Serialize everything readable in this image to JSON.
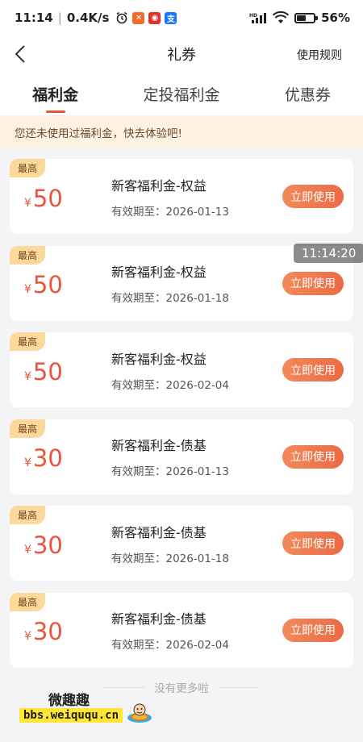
{
  "status_bar": {
    "time": "11:14",
    "speed": "0.4K/s",
    "battery": "56%",
    "battery_level": 0.56,
    "network": "HD"
  },
  "nav": {
    "title": "礼券",
    "rules": "使用规则"
  },
  "tabs": [
    {
      "label": "福利金",
      "active": true
    },
    {
      "label": "定投福利金",
      "active": false
    },
    {
      "label": "优惠券",
      "active": false
    }
  ],
  "notice": "您还未使用过福利金，快去体验吧!",
  "coupons": [
    {
      "tag": "最高",
      "currency": "¥",
      "amount": "50",
      "title": "新客福利金-权益",
      "expiry": "有效期至：2026-01-13",
      "button": "立即使用"
    },
    {
      "tag": "最高",
      "currency": "¥",
      "amount": "50",
      "title": "新客福利金-权益",
      "expiry": "有效期至：2026-01-18",
      "button": "立即使用"
    },
    {
      "tag": "最高",
      "currency": "¥",
      "amount": "50",
      "title": "新客福利金-权益",
      "expiry": "有效期至：2026-02-04",
      "button": "立即使用"
    },
    {
      "tag": "最高",
      "currency": "¥",
      "amount": "30",
      "title": "新客福利金-债基",
      "expiry": "有效期至：2026-01-13",
      "button": "立即使用"
    },
    {
      "tag": "最高",
      "currency": "¥",
      "amount": "30",
      "title": "新客福利金-债基",
      "expiry": "有效期至：2026-01-18",
      "button": "立即使用"
    },
    {
      "tag": "最高",
      "currency": "¥",
      "amount": "30",
      "title": "新客福利金-债基",
      "expiry": "有效期至：2026-02-04",
      "button": "立即使用"
    }
  ],
  "footer": "没有更多啦",
  "overlay_time": "11:14:20",
  "watermark": {
    "title": "微趣趣",
    "url": "bbs.weiququ.cn"
  },
  "colors": {
    "accent": "#e8553b",
    "button_start": "#f28a5a",
    "button_end": "#ec6a44",
    "tag_bg": "#fcd99a",
    "notice_bg": "#fdf2e2"
  }
}
